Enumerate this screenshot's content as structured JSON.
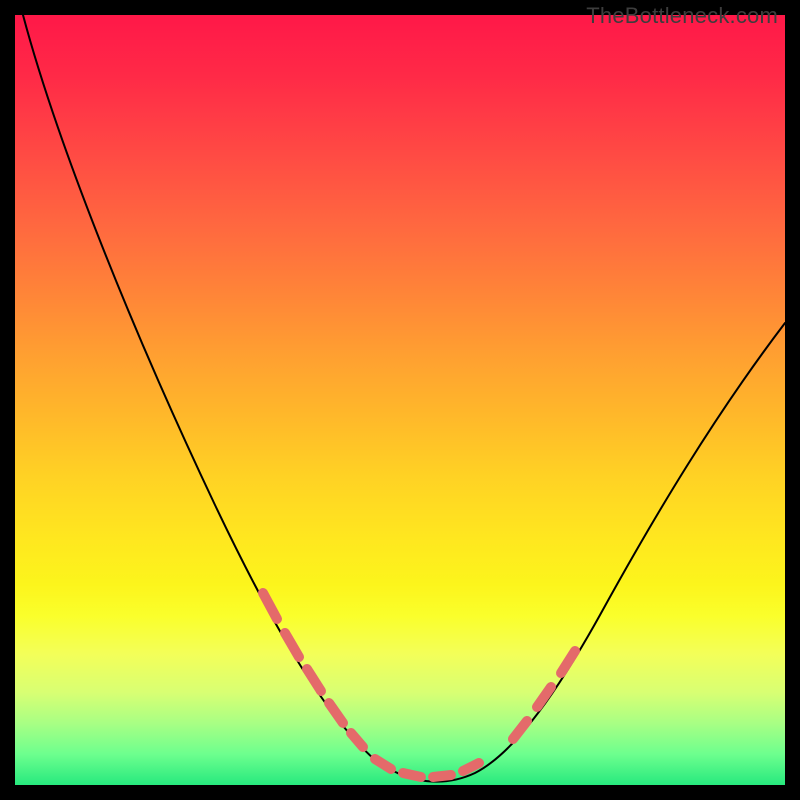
{
  "watermark": "TheBottleneck.com",
  "chart_data": {
    "type": "line",
    "title": "",
    "xlabel": "",
    "ylabel": "",
    "xlim": [
      0,
      100
    ],
    "ylim": [
      0,
      100
    ],
    "grid": false,
    "legend": false,
    "series": [
      {
        "name": "bottleneck-curve",
        "x": [
          1,
          5,
          10,
          15,
          20,
          25,
          30,
          35,
          40,
          45,
          48,
          50,
          52,
          54,
          56,
          58,
          60,
          63,
          66,
          70,
          75,
          80,
          85,
          90,
          95,
          100
        ],
        "y": [
          100,
          92,
          82,
          72,
          62,
          52,
          42,
          32,
          22,
          12,
          7,
          4,
          2,
          1,
          0,
          0,
          1,
          3,
          6,
          11,
          19,
          28,
          37,
          46,
          54,
          60
        ]
      }
    ],
    "highlight_segments": [
      {
        "name": "left-descent",
        "x_range": [
          32,
          46
        ],
        "approx_y_range": [
          28,
          8
        ]
      },
      {
        "name": "trough",
        "x_range": [
          48,
          60
        ],
        "approx_y_range": [
          4,
          1
        ]
      },
      {
        "name": "right-ascent",
        "x_range": [
          63,
          71
        ],
        "approx_y_range": [
          3,
          12
        ]
      }
    ],
    "background_gradient": {
      "top": "#ff1848",
      "mid": "#ffd224",
      "bottom": "#27e97e"
    }
  }
}
